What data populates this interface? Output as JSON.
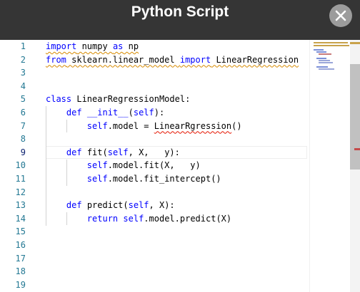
{
  "dialog": {
    "title": "Python Script",
    "close_icon": "close-x-icon"
  },
  "editor": {
    "active_line": 9,
    "line_numbers": [
      "1",
      "2",
      "3",
      "4",
      "5",
      "6",
      "7",
      "8",
      "9",
      "10",
      "11",
      "12",
      "13",
      "14",
      "15",
      "16",
      "17",
      "18",
      "19"
    ],
    "lines": [
      {
        "n": 1,
        "tokens": [
          {
            "t": "import",
            "k": "kw",
            "sq": true
          },
          {
            "t": " numpy ",
            "sq": true
          },
          {
            "t": "as",
            "k": "kw",
            "sq": true
          },
          {
            "t": " np",
            "sq": true
          }
        ]
      },
      {
        "n": 2,
        "tokens": [
          {
            "t": "from",
            "k": "kw",
            "sq": true
          },
          {
            "t": " sklearn.linear_model ",
            "sq": true
          },
          {
            "t": "import",
            "k": "kw",
            "sq": true
          },
          {
            "t": " LinearRegression",
            "sq": true
          }
        ]
      },
      {
        "n": 3,
        "tokens": []
      },
      {
        "n": 4,
        "tokens": []
      },
      {
        "n": 5,
        "tokens": [
          {
            "t": "class",
            "k": "kw"
          },
          {
            "t": " LinearRegressionModel:"
          }
        ]
      },
      {
        "n": 6,
        "tokens": [
          {
            "t": "    "
          },
          {
            "t": "def",
            "k": "kw"
          },
          {
            "t": " "
          },
          {
            "t": "__init__",
            "k": "kw2"
          },
          {
            "t": "("
          },
          {
            "t": "self",
            "k": "kw"
          },
          {
            "t": "):"
          }
        ]
      },
      {
        "n": 7,
        "tokens": [
          {
            "t": "        "
          },
          {
            "t": "self",
            "k": "kw"
          },
          {
            "t": ".model = "
          },
          {
            "t": "LinearRgression",
            "sqr": true
          },
          {
            "t": "()"
          }
        ]
      },
      {
        "n": 8,
        "tokens": []
      },
      {
        "n": 9,
        "tokens": [
          {
            "t": "    "
          },
          {
            "t": "def",
            "k": "kw"
          },
          {
            "t": " fit("
          },
          {
            "t": "self",
            "k": "kw"
          },
          {
            "t": ", X,   y):"
          }
        ]
      },
      {
        "n": 10,
        "tokens": [
          {
            "t": "        "
          },
          {
            "t": "self",
            "k": "kw"
          },
          {
            "t": ".model.fit(X,   y)"
          }
        ]
      },
      {
        "n": 11,
        "tokens": [
          {
            "t": "        "
          },
          {
            "t": "self",
            "k": "kw"
          },
          {
            "t": ".model.fit_intercept()"
          }
        ]
      },
      {
        "n": 12,
        "tokens": []
      },
      {
        "n": 13,
        "tokens": [
          {
            "t": "    "
          },
          {
            "t": "def",
            "k": "kw"
          },
          {
            "t": " predict("
          },
          {
            "t": "self",
            "k": "kw"
          },
          {
            "t": ", X):"
          }
        ]
      },
      {
        "n": 14,
        "tokens": [
          {
            "t": "        "
          },
          {
            "t": "return",
            "k": "kw"
          },
          {
            "t": " "
          },
          {
            "t": "self",
            "k": "kw"
          },
          {
            "t": ".model.predict(X)"
          }
        ]
      },
      {
        "n": 15,
        "tokens": []
      },
      {
        "n": 16,
        "tokens": []
      },
      {
        "n": 17,
        "tokens": []
      },
      {
        "n": 18,
        "tokens": []
      },
      {
        "n": 19,
        "tokens": []
      }
    ]
  },
  "colors": {
    "header_bg": "#353535",
    "keyword": "#0000ff",
    "line_number": "#237893",
    "warning_squiggle": "#d68a00",
    "error_squiggle": "#e51400"
  }
}
